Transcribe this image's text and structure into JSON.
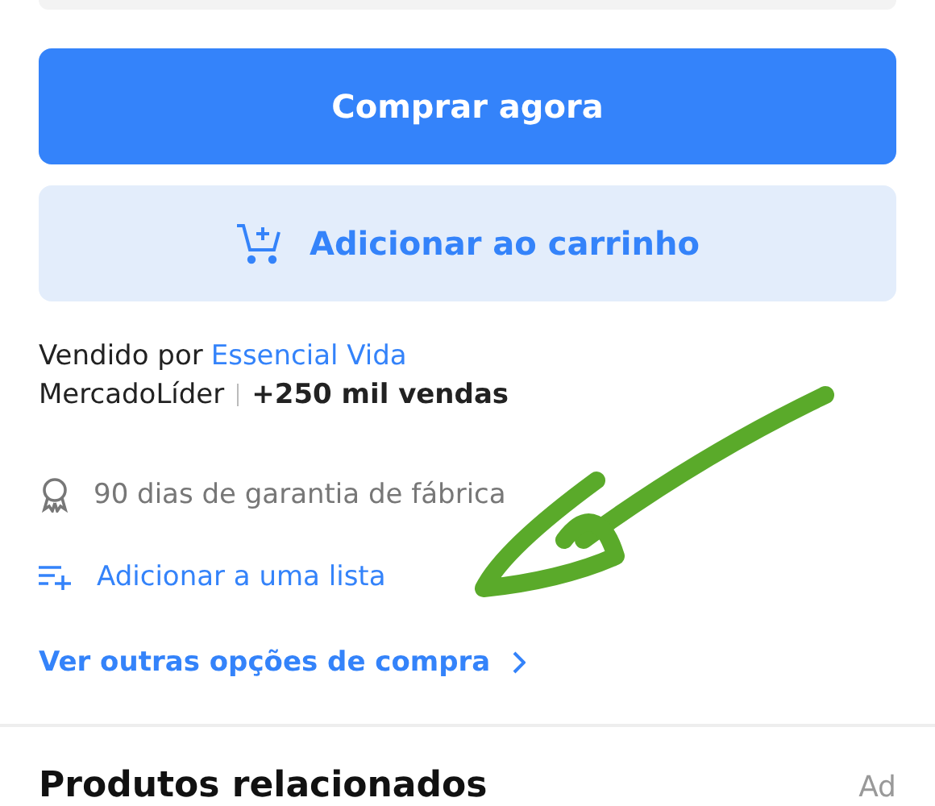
{
  "buttons": [
    {
      "kind": "primary",
      "label": "Comprar agora"
    },
    {
      "kind": "secondary",
      "label": "Adicionar ao carrinho"
    }
  ],
  "seller": {
    "prefix": "Vendido por",
    "name": "Essencial Vida",
    "badge": "MercadoLíder",
    "sales": "+250 mil vendas"
  },
  "warranty": "90 dias de garantia de fábrica",
  "add_to_list": "Adicionar a uma lista",
  "more_options": "Ver outras opções de compra",
  "related": {
    "title": "Produtos relacionados",
    "ad": "Ad"
  }
}
